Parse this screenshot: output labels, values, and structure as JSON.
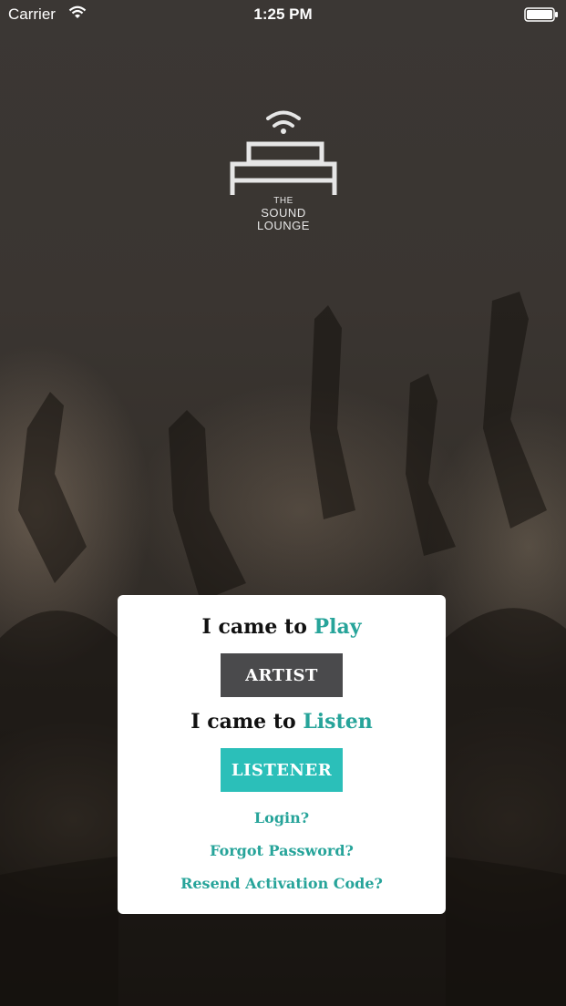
{
  "status_bar": {
    "carrier": "Carrier",
    "time": "1:25 PM",
    "wifi_icon": "wifi-icon",
    "battery_icon": "battery-icon"
  },
  "logo": {
    "line1": "THE",
    "line2": "SOUND",
    "line3": "LOUNGE",
    "icon": "sofa-broadcast-icon"
  },
  "card": {
    "play_prefix": "I came to",
    "play_accent": "Play",
    "artist_button": "ARTIST",
    "listen_prefix": "I came to",
    "listen_accent": "Listen",
    "listener_button": "LISTENER",
    "login_link": "Login?",
    "forgot_link": "Forgot Password?",
    "resend_link": "Resend Activation Code?"
  },
  "colors": {
    "accent": "#27a49a",
    "artist_button": "#4a4a4c",
    "listener_button": "#2bbfb9"
  }
}
